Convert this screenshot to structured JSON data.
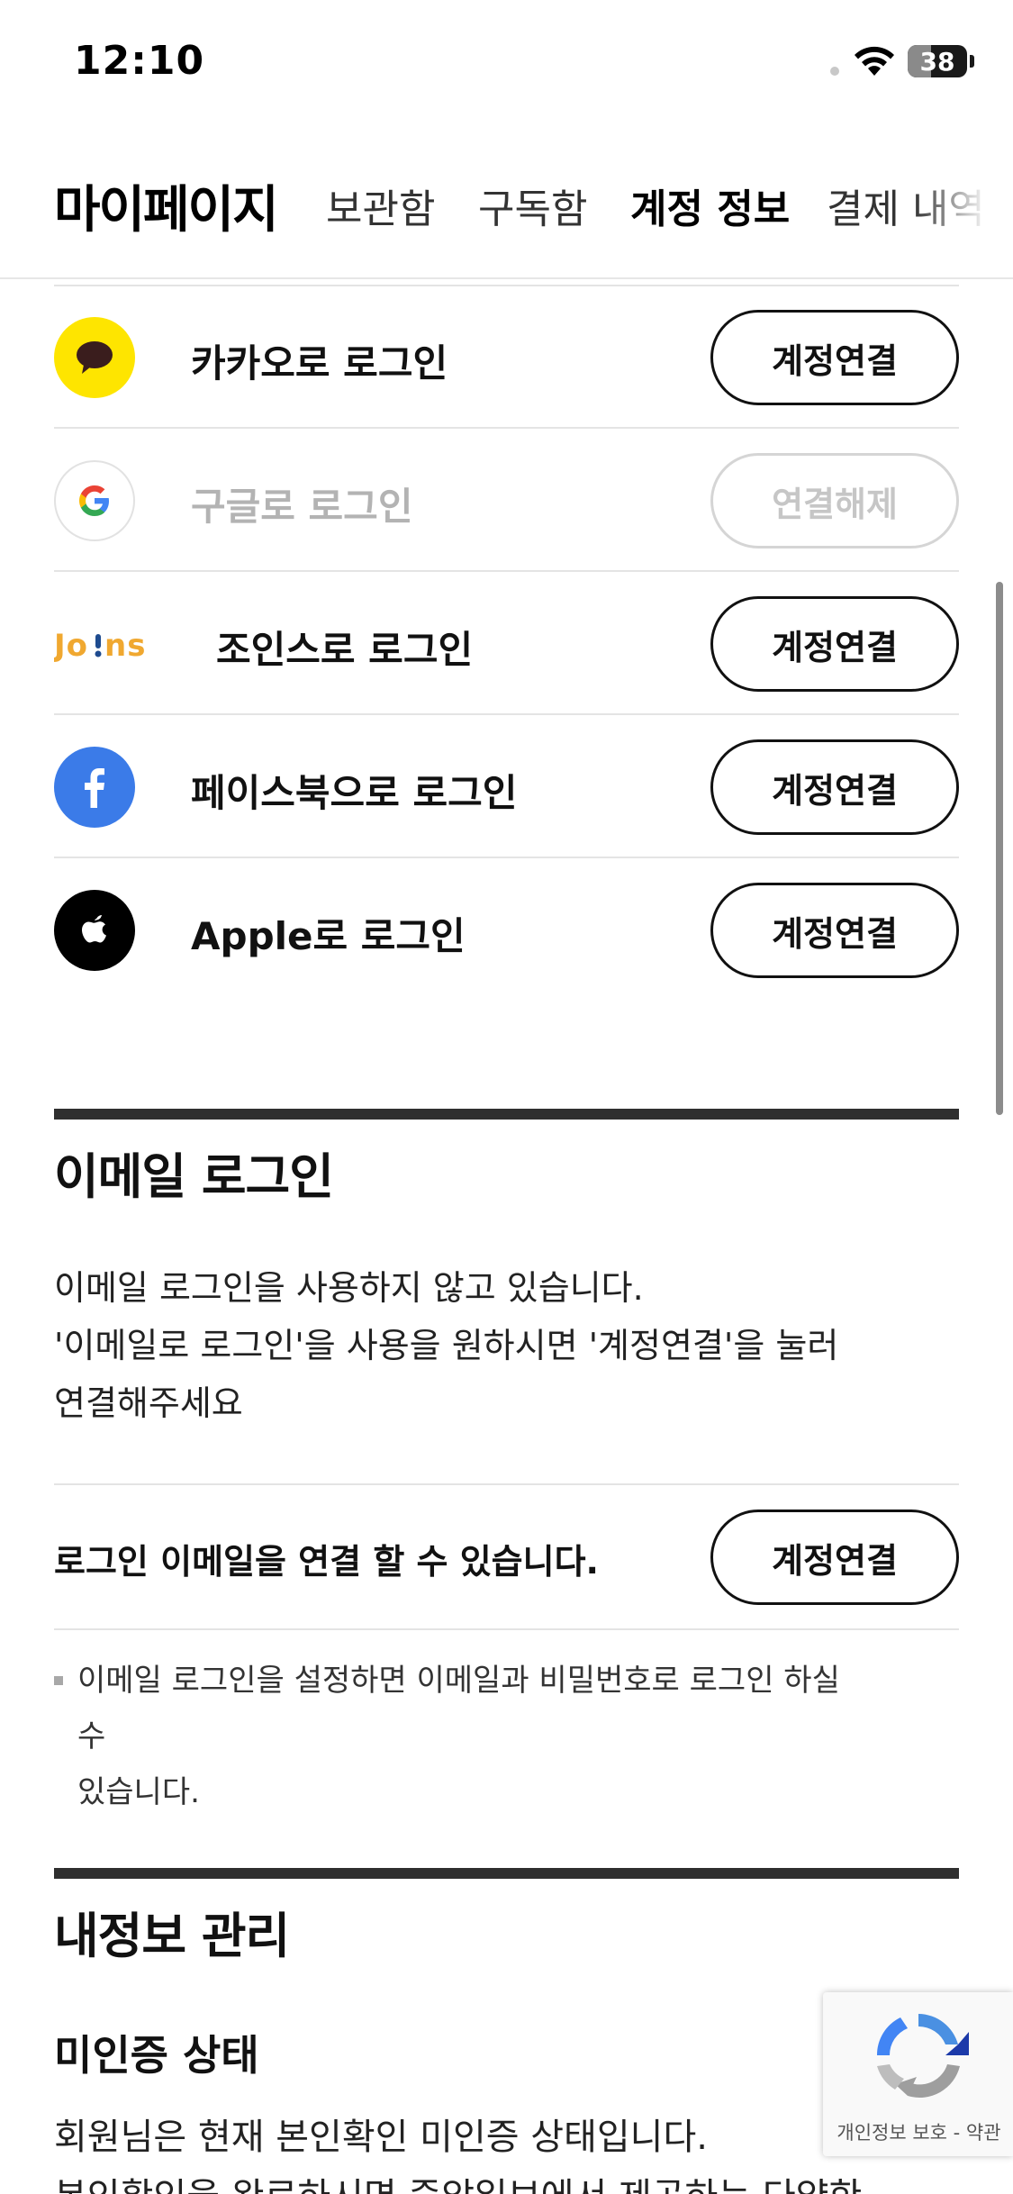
{
  "status_bar": {
    "time": "12:10",
    "battery": "38"
  },
  "header": {
    "title": "마이페이지",
    "tabs": [
      {
        "label": "보관함"
      },
      {
        "label": "구독함"
      },
      {
        "label": "계정 정보"
      },
      {
        "label": "결제 내역"
      }
    ],
    "active_tab": "계정 정보"
  },
  "social_logins": [
    {
      "label": "카카오로 로그인",
      "button": "계정연결",
      "icon": "kakao-icon",
      "color": "#FEE500"
    },
    {
      "label": "구글로 로그인",
      "button": "연결해제",
      "icon": "google-icon",
      "state": "disabled"
    },
    {
      "label": "조인스로 로그인",
      "button": "계정연결",
      "icon": "joins-icon",
      "logo_text": "JO!NS",
      "color": "#F0A830"
    },
    {
      "label": "페이스북으로 로그인",
      "button": "계정연결",
      "icon": "facebook-icon",
      "color": "#3B7BE8"
    },
    {
      "label": "Apple로 로그인",
      "button": "계정연결",
      "icon": "apple-icon",
      "color": "#000000"
    }
  ],
  "email_login": {
    "title": "이메일 로그인",
    "description_lines": [
      "이메일 로그인을 사용하지 않고 있습니다.",
      "'이메일로 로그인'을 사용을 원하시면 '계정연결'을 눌러",
      "연결해주세요"
    ],
    "connect_label": "로그인 이메일을 연결 할 수 있습니다.",
    "connect_button": "계정연결",
    "note_lines": [
      "이메일 로그인을 설정하면 이메일과 비밀번호로 로그인 하실 수",
      "있습니다."
    ]
  },
  "profile": {
    "title": "내정보 관리",
    "subtitle": "미인증 상태",
    "text_lines": [
      "회원님은 현재 본인확인 미인증 상태입니다.",
      "본인확인을 완료하시면 중앙일보에서 제공하는 다양한"
    ]
  },
  "recaptcha": {
    "text": "개인정보 보호 - 약관",
    "icon": "recaptcha-icon"
  }
}
